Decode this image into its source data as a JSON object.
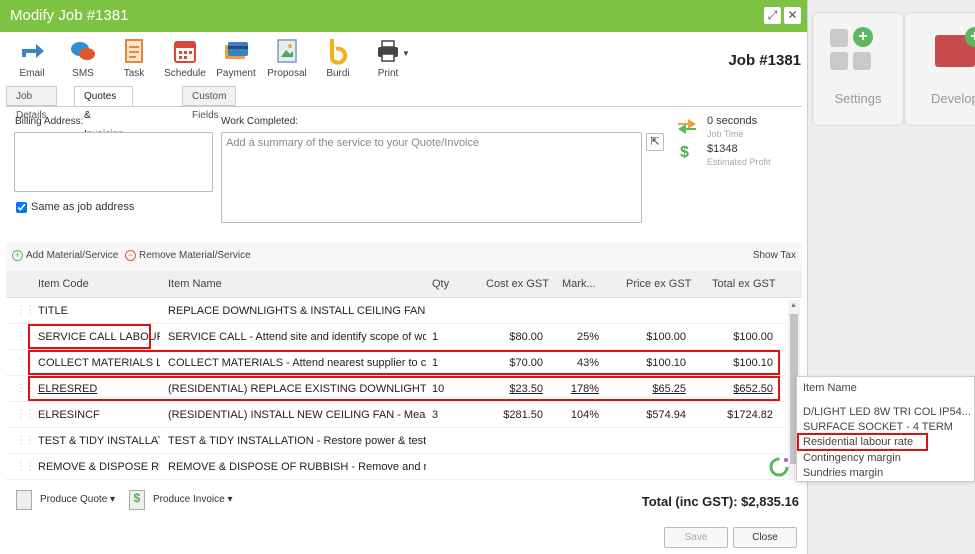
{
  "background": {
    "cards": [
      {
        "label": "Settings"
      },
      {
        "label": "Develop"
      }
    ]
  },
  "dialog": {
    "title": "Modify Job #1381",
    "job_number": "Job #1381",
    "toolbar": [
      {
        "label": "Email",
        "icon": "email-icon"
      },
      {
        "label": "SMS",
        "icon": "sms-icon"
      },
      {
        "label": "Task",
        "icon": "task-icon"
      },
      {
        "label": "Schedule",
        "icon": "schedule-icon"
      },
      {
        "label": "Payment",
        "icon": "payment-icon"
      },
      {
        "label": "Proposal",
        "icon": "proposal-icon"
      },
      {
        "label": "Burdi",
        "icon": "burdi-icon"
      },
      {
        "label": "Print",
        "icon": "print-icon"
      }
    ],
    "tabs": [
      {
        "label": "Job Details",
        "active": false
      },
      {
        "label": "Quotes & Invoicing",
        "active": true
      },
      {
        "label": "Custom Fields",
        "active": false
      }
    ],
    "billing_label": "Billing Address:",
    "work_label": "Work Completed:",
    "work_placeholder": "Add a summary of the service to your Quote/Invoice",
    "same_address_label": "Same as job address",
    "job_time_value": "0 seconds",
    "job_time_label": "Job Time",
    "profit_value": "$1348",
    "profit_label": "Estimated Profit",
    "add_material": "Add Material/Service",
    "remove_material": "Remove Material/Service",
    "show_tax": "Show Tax",
    "columns": [
      "Item Code",
      "Item Name",
      "Qty",
      "Cost ex GST",
      "Mark...",
      "Price ex GST",
      "Total ex GST"
    ],
    "rows": [
      {
        "code": "TITLE",
        "name": "REPLACE DOWNLIGHTS & INSTALL CEILING FANS",
        "qty": "",
        "cost": "",
        "markup": "",
        "price": "",
        "total": ""
      },
      {
        "code": "SERVICE CALL LABOUR",
        "name": "SERVICE CALL - Attend site and identify scope of wor...",
        "qty": "1",
        "cost": "$80.00",
        "markup": "25%",
        "price": "$100.00",
        "total": "$100.00"
      },
      {
        "code": "COLLECT MATERIALS LA...",
        "name": "COLLECT MATERIALS - Attend nearest supplier to co...",
        "qty": "1",
        "cost": "$70.00",
        "markup": "43%",
        "price": "$100.10",
        "total": "$100.10"
      },
      {
        "code": "ELRESRED",
        "name": "(RESIDENTIAL) REPLACE EXISTING DOWNLIGHT - Re...",
        "qty": "10",
        "cost": "$23.50",
        "markup": "178%",
        "price": "$65.25",
        "total": "$652.50"
      },
      {
        "code": "ELRESINCF",
        "name": "(RESIDENTIAL) INSTALL NEW CEILING FAN - Measure...",
        "qty": "3",
        "cost": "$281.50",
        "markup": "104%",
        "price": "$574.94",
        "total": "$1724.82"
      },
      {
        "code": "TEST & TIDY INSTALLATI...",
        "name": "TEST & TIDY INSTALLATION - Restore power & test f...",
        "qty": "",
        "cost": "",
        "markup": "",
        "price": "",
        "total": ""
      },
      {
        "code": "REMOVE & DISPOSE RU...",
        "name": "REMOVE & DISPOSE OF RUBBISH - Remove and res...",
        "qty": "",
        "cost": "",
        "markup": "",
        "price": "",
        "total": ""
      }
    ],
    "produce_quote": "Produce Quote",
    "produce_invoice": "Produce Invoice",
    "total_label": "Total (inc GST): $2,835.16",
    "save_label": "Save",
    "close_label": "Close"
  },
  "popup": {
    "header": "Item Name",
    "items": [
      "D/LIGHT LED 8W TRI COL IP54...",
      "SURFACE SOCKET - 4 TERM",
      "Residential labour rate",
      "Contingency margin",
      "Sundries margin"
    ]
  },
  "colors": {
    "titlebar": "#7dc243",
    "highlight": "#dd1111"
  }
}
